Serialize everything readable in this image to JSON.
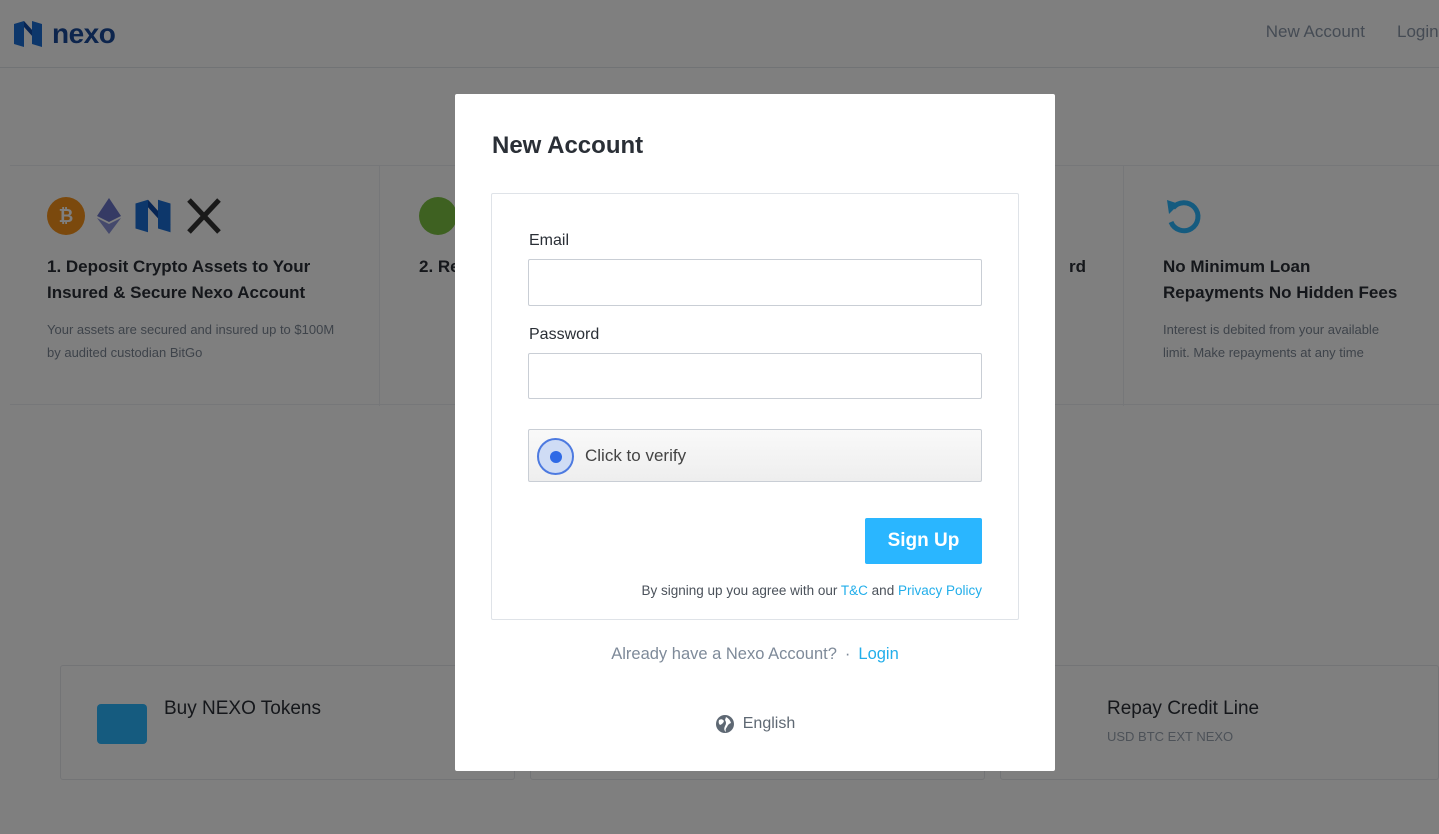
{
  "header": {
    "logo_text": "nexo",
    "nav": {
      "new_account": "New Account",
      "login": "Login"
    }
  },
  "features": [
    {
      "title": "1. Deposit Crypto Assets to Your Insured & Secure Nexo Account",
      "text": "Your assets are secured and insured up to $100M by audited custodian BitGo"
    },
    {
      "title": "2. Re",
      "text": ""
    },
    {
      "title": "rd",
      "text": ""
    },
    {
      "title": "No Minimum Loan Repayments No Hidden Fees",
      "text": "Interest is debited from your available limit. Make repayments at any time"
    }
  ],
  "bg_cards": [
    {
      "title": "Buy NEXO Tokens",
      "subtitle": ""
    },
    {
      "title": "Repay Credit Line",
      "subtitle": "USD BTC EXT NEXO"
    }
  ],
  "modal": {
    "title": "New Account",
    "email_label": "Email",
    "email_value": "",
    "password_label": "Password",
    "password_value": "",
    "verify_text": "Click to verify",
    "signup_label": "Sign Up",
    "agree_prefix": "By signing up you agree with our",
    "tc_link": "T&C",
    "and_text": "and",
    "privacy_link": "Privacy Policy",
    "already_text": "Already have a Nexo Account?",
    "separator": "·",
    "login_link": "Login",
    "language": "English"
  },
  "colors": {
    "accent": "#2ab6ff",
    "link": "#22aeea",
    "overlay": "rgba(0,0,0,0.5)"
  }
}
